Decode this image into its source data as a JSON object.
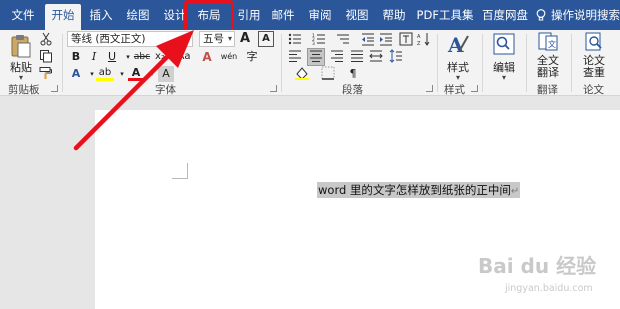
{
  "tabs": [
    {
      "label": "文件"
    },
    {
      "label": "开始"
    },
    {
      "label": "插入"
    },
    {
      "label": "绘图"
    },
    {
      "label": "设计"
    },
    {
      "label": "布局"
    },
    {
      "label": "引用"
    },
    {
      "label": "邮件"
    },
    {
      "label": "审阅"
    },
    {
      "label": "视图"
    },
    {
      "label": "帮助"
    },
    {
      "label": "PDF工具集"
    },
    {
      "label": "百度网盘"
    }
  ],
  "tell_me": "操作说明搜索",
  "ribbon": {
    "clipboard": {
      "paste_label": "粘贴",
      "group_label": "剪贴板"
    },
    "font": {
      "font_name": "等线 (西文正文)",
      "font_size": "五号",
      "increase_size": "A",
      "decrease_size": "A",
      "case": "Aa",
      "clear_format": "A",
      "phonetic": "wén",
      "char_border": "A",
      "bold": "B",
      "italic": "I",
      "underline": "U",
      "strikethrough": "abc",
      "subscript": "x₂",
      "superscript": "x²",
      "text_effects": "A",
      "highlight": "ab",
      "font_color": "A",
      "char_shading": "A",
      "encircle": "字",
      "group_label": "字体"
    },
    "paragraph": {
      "group_label": "段落"
    },
    "styles": {
      "styles_label": "样式",
      "group_label": "样式"
    },
    "editing": {
      "label": "编辑"
    },
    "translate": {
      "label_line1": "全文",
      "label_line2": "翻译",
      "group_label": "翻译"
    },
    "paper": {
      "label_line1": "论文",
      "label_line2": "查重",
      "group_label": "论文"
    }
  },
  "document": {
    "selected_text": "word 里的文字怎样放到纸张的正中间",
    "paragraph_mark": "↵"
  },
  "watermark": {
    "logo_text": "Bai du 经验",
    "url": "jingyan.baidu.com"
  },
  "colors": {
    "tab_bar": "#2b579a",
    "ribbon": "#f3f3f3",
    "annotation_red": "#e8101b",
    "selection": "#c8c8c8"
  }
}
